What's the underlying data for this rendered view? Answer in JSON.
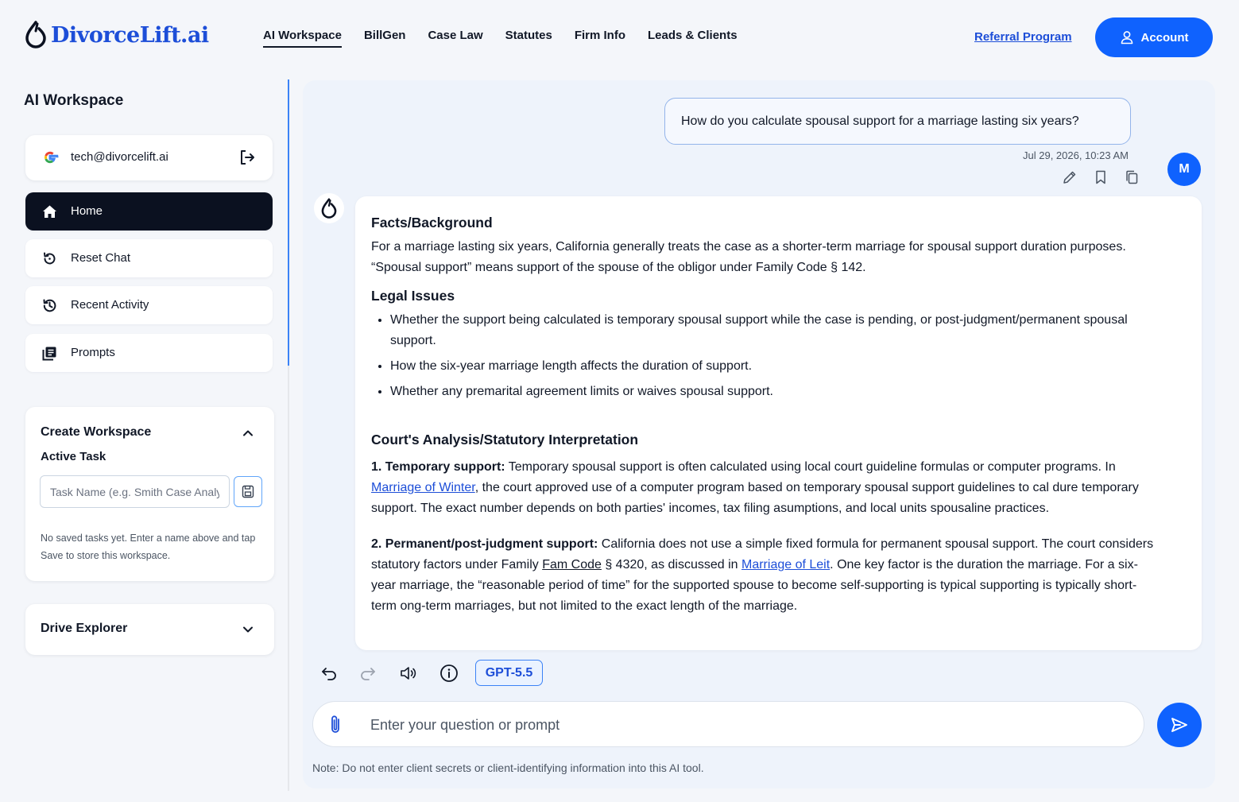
{
  "brand": {
    "name": "DivorceLift.ai",
    "accent": "#0f62fe",
    "link_color": "#1d4ed8"
  },
  "nav": {
    "items": [
      {
        "label": "AI Workspace",
        "active": true
      },
      {
        "label": "BillGen"
      },
      {
        "label": "Case Law"
      },
      {
        "label": "Statutes"
      },
      {
        "label": "Firm Info"
      },
      {
        "label": "Leads & Clients"
      }
    ],
    "referral": "Referral Program",
    "account": "Account"
  },
  "sidebar": {
    "title": "AI Workspace",
    "google": {
      "email": "tech@divorcelift.ai",
      "icon": "google-icon",
      "logout_icon": "logout-icon"
    },
    "items": [
      {
        "label": "Home",
        "icon": "home-icon",
        "active": true
      },
      {
        "label": "Reset Chat",
        "icon": "reset-icon"
      },
      {
        "label": "Recent Activity",
        "icon": "history-icon"
      },
      {
        "label": "Prompts",
        "icon": "prompts-icon"
      }
    ],
    "workspace": {
      "title": "Create Workspace",
      "subtitle": "Active Task",
      "placeholder": "Task Name (e.g. Smith Case Analysis)",
      "note": "No saved tasks yet. Enter a name above and tap Save to store this workspace."
    },
    "drive": {
      "title": "Drive Explorer"
    }
  },
  "chat": {
    "user_message": "How do you calculate spousal support for a marriage lasting six years?",
    "timestamp": "Jul 29, 2026, 10:23 AM",
    "avatar_initial": "M",
    "answer": {
      "facts_heading": "Facts/Background",
      "facts_text": "For a marriage lasting six years, California generally treats the case as a shorter-term marriage for spousal support duration purposes. “Spousal support” means support of the spouse of the obligor under Family Code § 142.",
      "issues_heading": "Legal Issues",
      "issues": [
        "Whether the support being calculated is temporary spousal support while the case is pending, or post-judgment/permanent spousal support.",
        "How the six-year marriage length affects the duration of support.",
        "Whether any premarital agreement limits or waives spousal support."
      ],
      "analysis_heading": "Court's Analysis/Statutory Interpretation",
      "point1": {
        "label": "1. Temporary support:",
        "text_a": " Temporary spousal support is often calculated using local court guideline formulas or computer programs. In ",
        "case": "Marriage of Winter",
        "text_b": ", the court approved use of a computer program based on temporary spousal support guidelines to cal",
        "text_c": "dure temporary support. The exact number depends on both parties' incomes, tax filing asumptions, and local units spousaline practices."
      },
      "point2": {
        "label": "2. Permanent/post-judgment support:",
        "text_a": " California does not use a simple fixed formula for permanent spousal support. The court considers statutory factors under Family ",
        "code": "Fam Code",
        "text_b": " § 4320, as discussed in ",
        "case": "Marriage of Leit",
        "text_c": ". One key factor is the duration the marriage. For a six-year marriage, the “reasonable period of time” for the supported spouse to become self-supporting is typical supporting is typically short-term ong-term marriages, but not limited to the exact length of the marriage."
      }
    }
  },
  "composer": {
    "model": "GPT-5.5",
    "placeholder": "Enter your question or prompt",
    "note": "Note: Do not enter client secrets or client-identifying information into this AI tool."
  }
}
